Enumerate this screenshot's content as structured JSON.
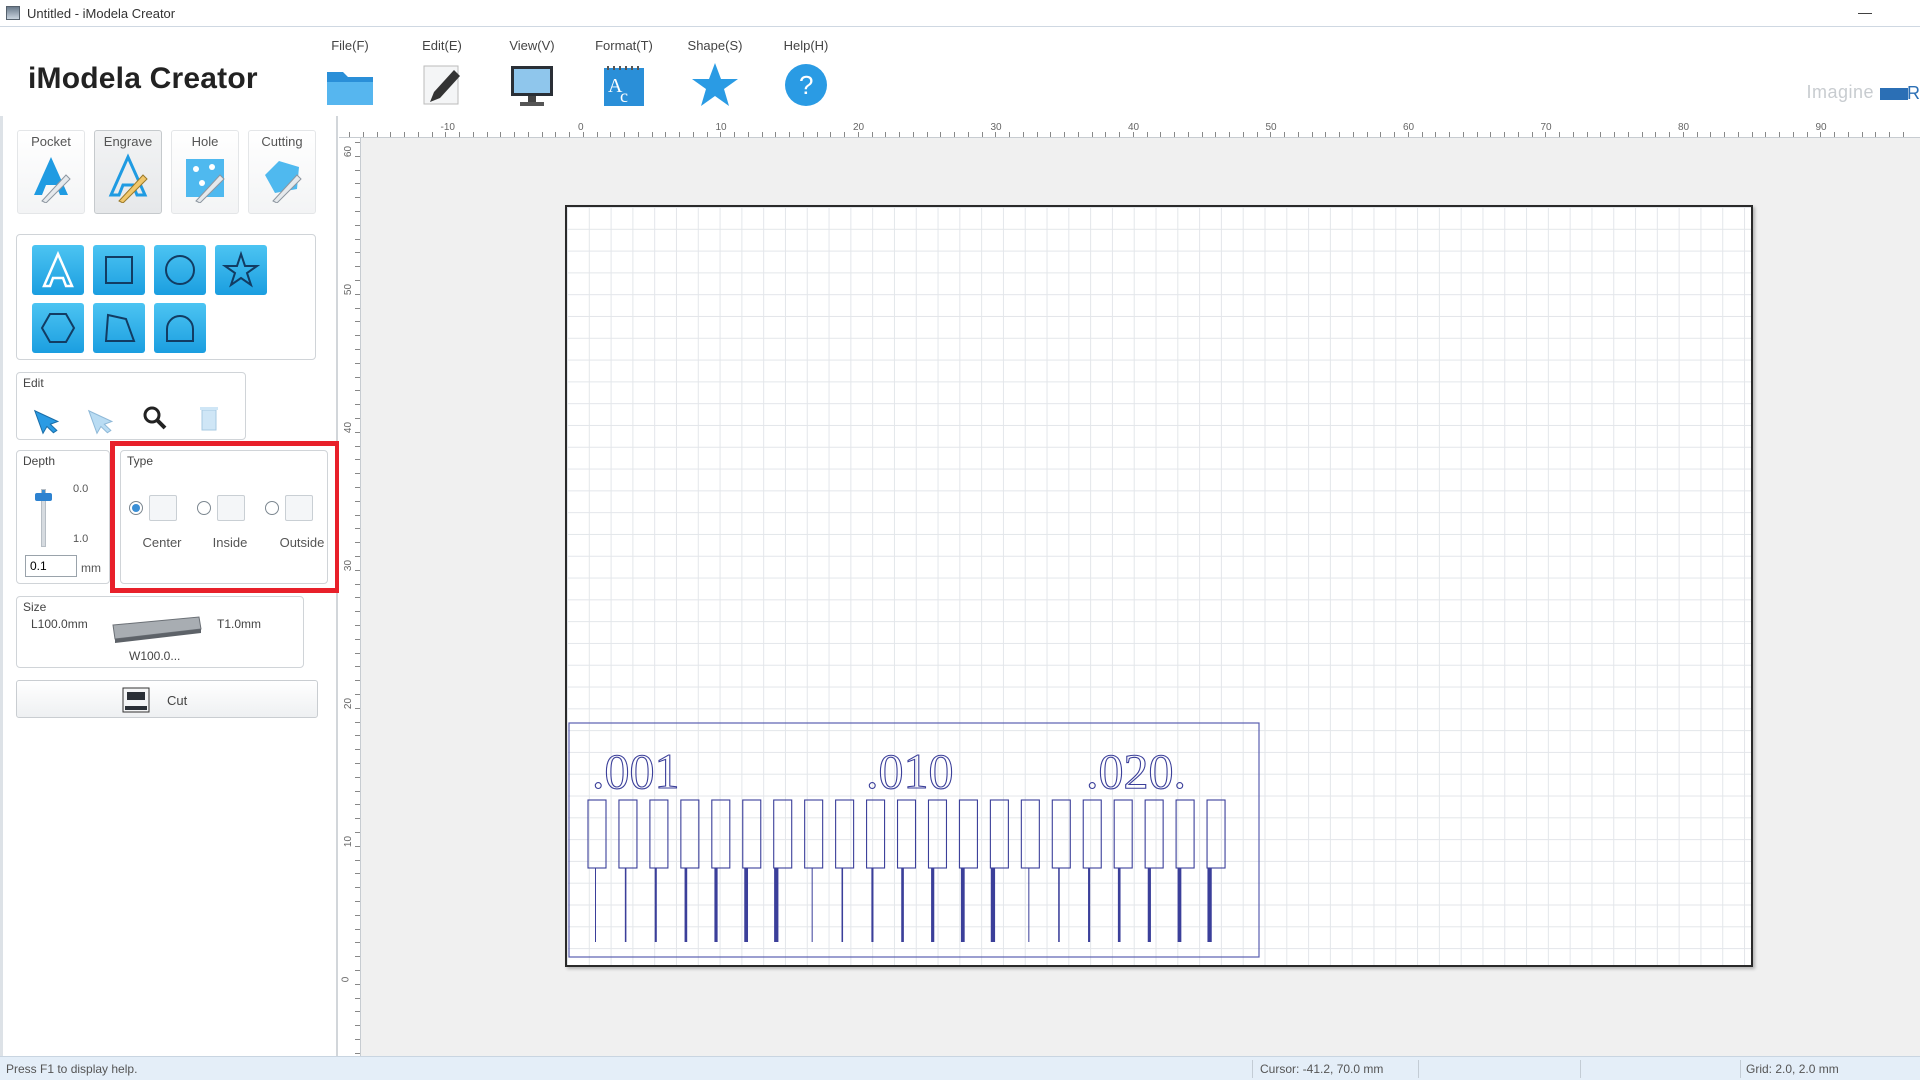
{
  "window": {
    "title": "Untitled - iModela Creator",
    "minimize": "—"
  },
  "brand": "iModela Creator",
  "watermark": {
    "text": "Imagine",
    "accent": "R"
  },
  "menu": [
    {
      "label": "File(F)",
      "icon": "folder-icon"
    },
    {
      "label": "Edit(E)",
      "icon": "pen-icon"
    },
    {
      "label": "View(V)",
      "icon": "monitor-icon"
    },
    {
      "label": "Format(T)",
      "icon": "text-format-icon"
    },
    {
      "label": "Shape(S)",
      "icon": "star-icon"
    },
    {
      "label": "Help(H)",
      "icon": "help-icon"
    }
  ],
  "modes": [
    {
      "label": "Pocket",
      "active": false
    },
    {
      "label": "Engrave",
      "active": true
    },
    {
      "label": "Hole",
      "active": false
    },
    {
      "label": "Cutting",
      "active": false
    }
  ],
  "shapes": [
    "text-shape-icon",
    "rectangle-icon",
    "circle-icon",
    "star-shape-icon",
    "hexagon-icon",
    "polygon-icon",
    "arch-icon"
  ],
  "edit": {
    "title": "Edit",
    "tools": [
      "select-arrow-icon",
      "node-edit-icon",
      "zoom-icon",
      "trash-icon"
    ]
  },
  "depth": {
    "title": "Depth",
    "top_tick": "0.0",
    "bottom_tick": "1.0",
    "value": "0.1",
    "unit": "mm",
    "level_fraction": 0.1
  },
  "type": {
    "title": "Type",
    "options": [
      {
        "label": "Center",
        "checked": true
      },
      {
        "label": "Inside",
        "checked": false
      },
      {
        "label": "Outside",
        "checked": false
      }
    ]
  },
  "size": {
    "title": "Size",
    "length": "L100.0mm",
    "thickness": "T1.0mm",
    "width": "W100.0..."
  },
  "cut": {
    "label": "Cut"
  },
  "ruler": {
    "h_labels": [
      "-10",
      "0",
      "10",
      "20",
      "30",
      "40",
      "50",
      "60",
      "70",
      "80",
      "90"
    ],
    "v_labels": [
      "60",
      "50",
      "40",
      "30",
      "20",
      "10",
      "0"
    ]
  },
  "design": {
    "labels": [
      ".001",
      ".010",
      ".020."
    ]
  },
  "status": {
    "help": "Press F1 to display help.",
    "cursor": "Cursor: -41.2, 70.0 mm",
    "grid": "Grid: 2.0, 2.0 mm"
  },
  "colors": {
    "accent": "#1b9ee0",
    "highlight": "#e8202a",
    "design_stroke": "#3b3f9a"
  }
}
